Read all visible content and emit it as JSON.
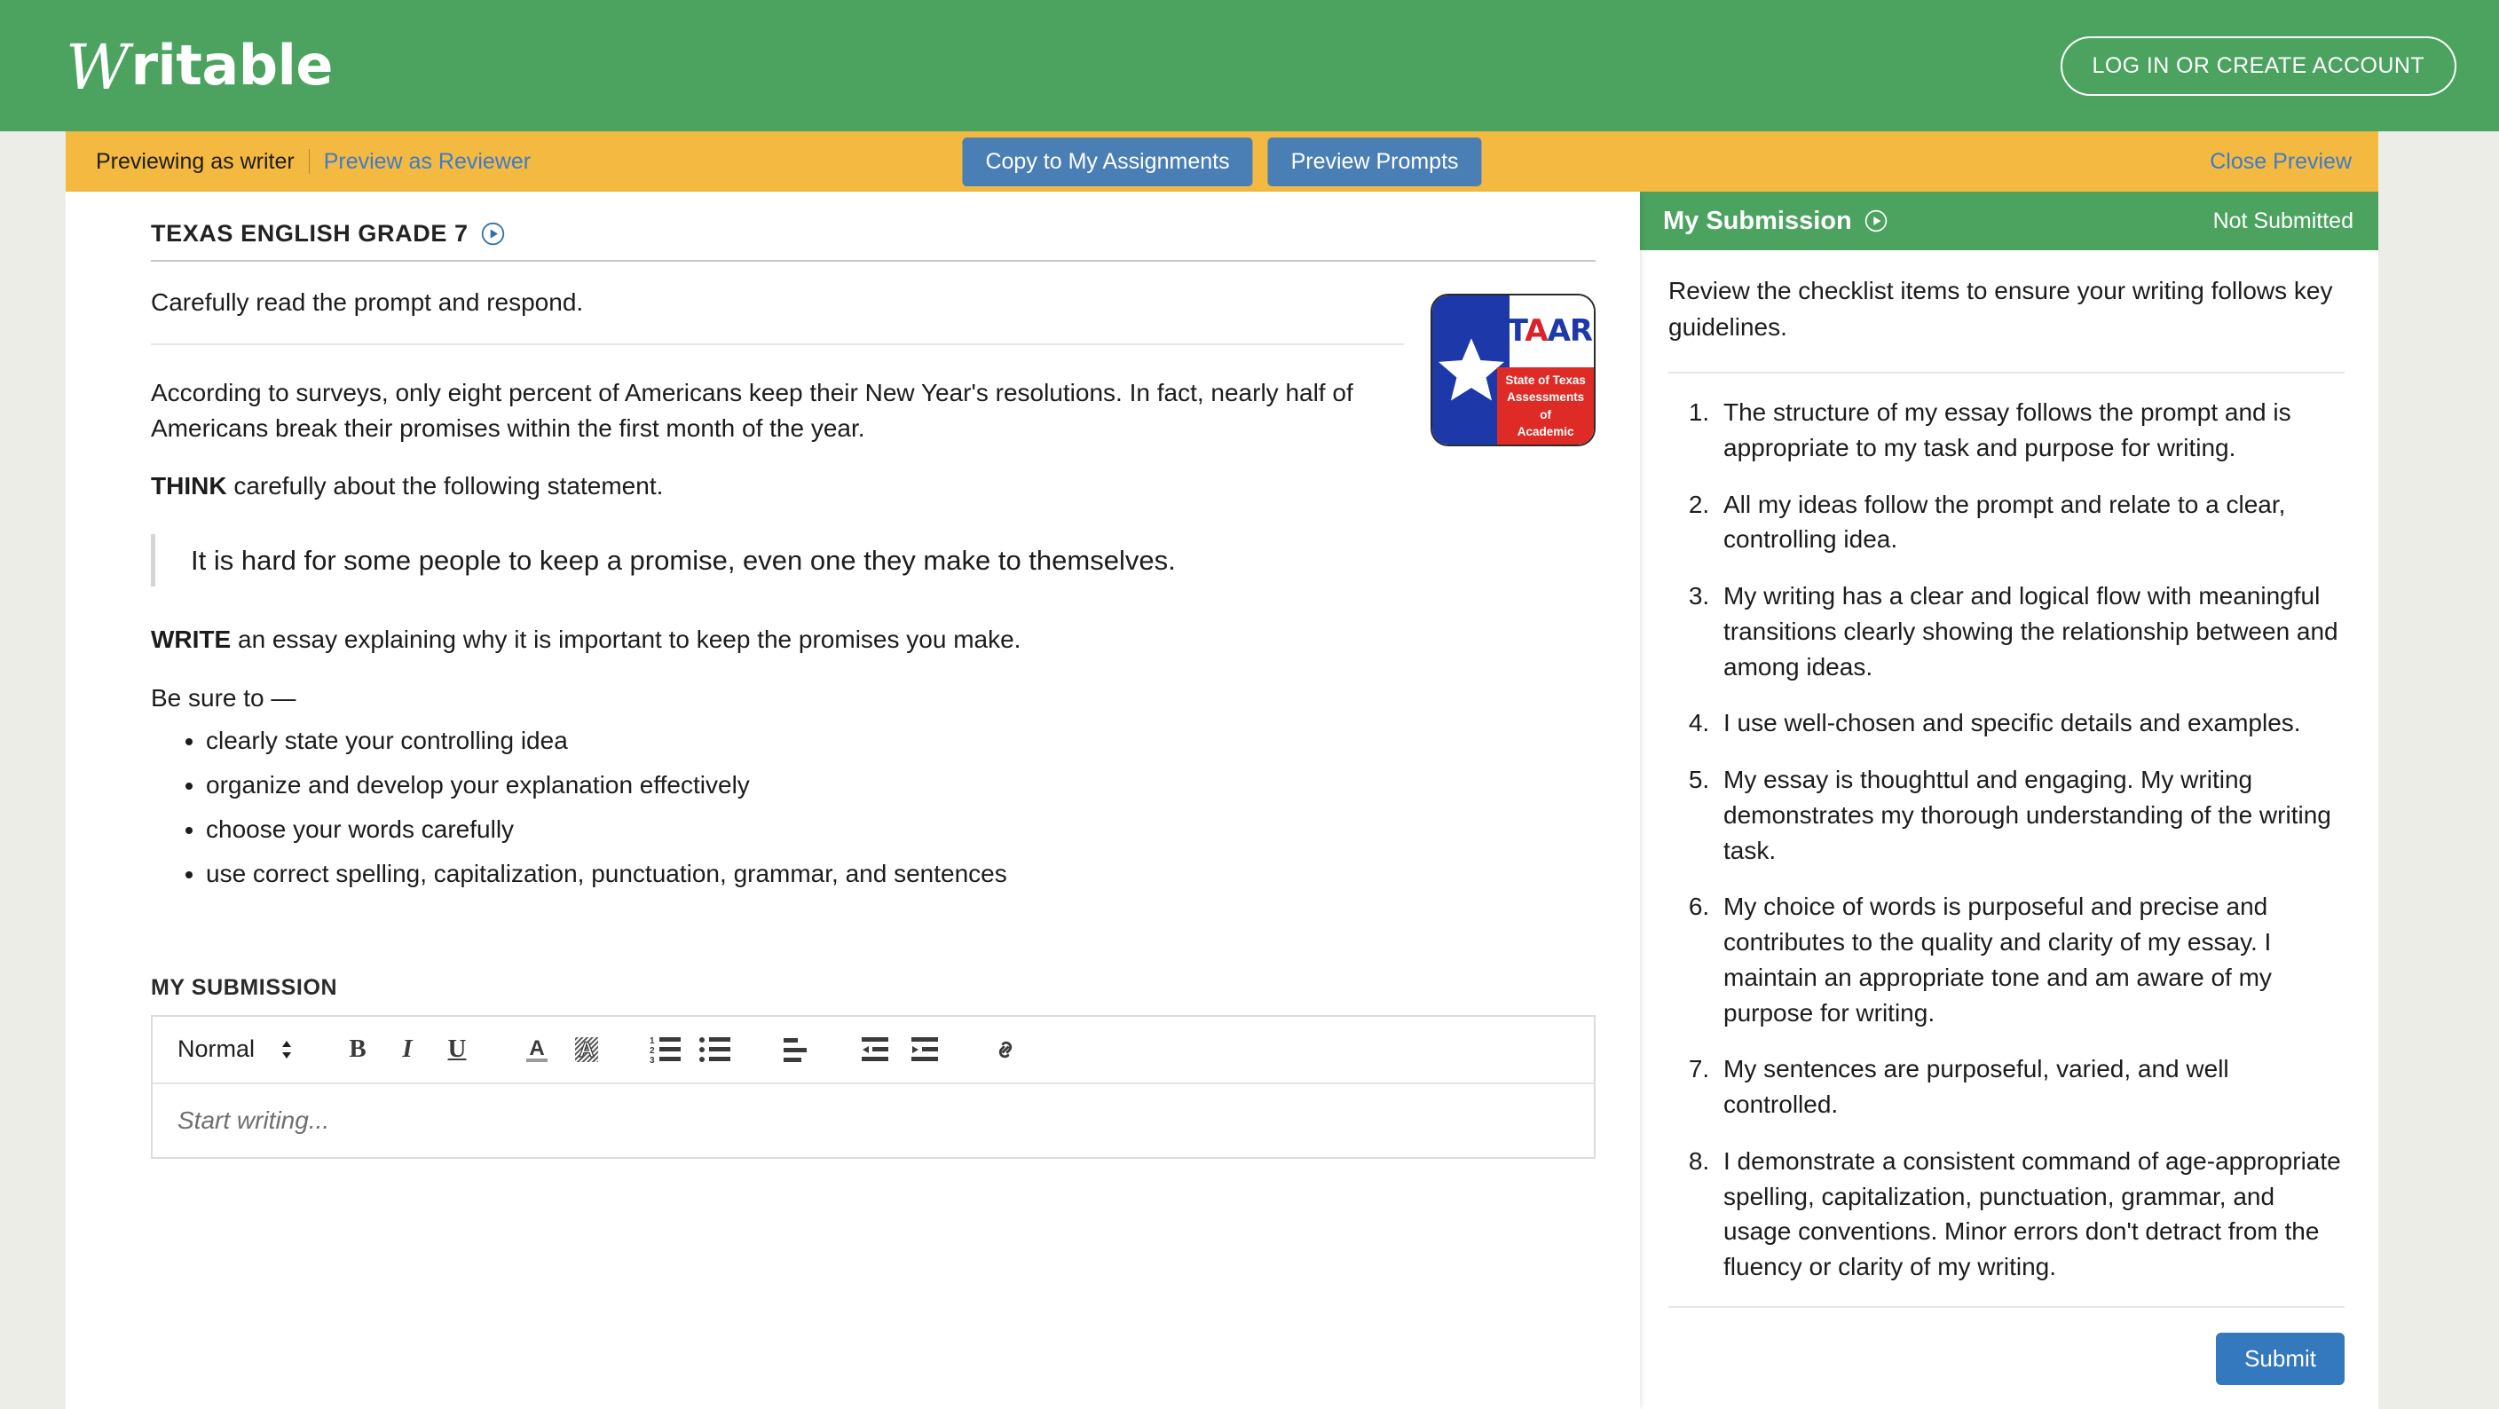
{
  "colors": {
    "brand_green": "#4ba35f",
    "preview_orange": "#f4b940",
    "link_blue": "#3d7cc9",
    "button_blue": "#4a7fb5",
    "submit_blue": "#3478bd",
    "page_background": "#ecede7"
  },
  "header": {
    "brand_w": "W",
    "brand_rest": "ritable",
    "login_label": "LOG IN OR CREATE ACCOUNT"
  },
  "preview_bar": {
    "status_text": "Previewing as writer",
    "reviewer_link": "Preview as Reviewer",
    "copy_button": "Copy to My Assignments",
    "prompts_button": "Preview Prompts",
    "close_link": "Close Preview"
  },
  "assignment": {
    "course_title": "TEXAS ENGLISH GRADE 7",
    "instruction": "Carefully read the prompt and respond.",
    "paragraph": "According to surveys, only eight percent of Americans keep their New Year's resolutions. In fact, nearly half of Americans break their promises within the first month of the year.",
    "think_bold": "THINK",
    "think_rest": " carefully about the following statement.",
    "statement": "It is hard for some people to keep a promise, even one they make to themselves.",
    "write_bold": "WRITE",
    "write_rest": " an essay explaining why it is important to keep the promises you make.",
    "be_sure_to": "Be sure to —",
    "bullets": [
      "clearly state your controlling idea",
      "organize and develop your explanation effectively",
      "choose your words carefully",
      "use correct spelling, capitalization, punctuation, grammar, and sentences"
    ]
  },
  "staar_logo": {
    "word_st": "ST",
    "word_a_red": "A",
    "word_ar": "AR",
    "line1": "State of Texas",
    "line2": "Assessments of",
    "line3": "Academic Readiness"
  },
  "submission": {
    "section_label": "MY SUBMISSION",
    "format_value": "Normal",
    "placeholder": "Start writing..."
  },
  "right_panel": {
    "title": "My Submission",
    "status": "Not Submitted",
    "intro": "Review the checklist items to ensure your writing follows key guidelines.",
    "checklist": [
      "The structure of my essay follows the prompt and is appropriate to my task and purpose for writing.",
      "All my ideas follow the prompt and relate to a clear, controlling idea.",
      "My writing has a clear and logical flow with meaningful transitions clearly showing the relationship between and among ideas.",
      "I use well-chosen and specific details and examples.",
      "My essay is thoughttul and engaging. My writing demonstrates my thorough understanding of the writing task.",
      "My choice of words is purposeful and precise and contributes to the quality and clarity of my essay. I maintain an appropriate tone and am aware of my purpose for writing.",
      "My sentences are purposeful, varied, and well controlled.",
      "I demonstrate a consistent command of age-appropriate spelling, capitalization, punctuation, grammar, and usage conventions. Minor errors don't detract from the fluency or clarity of my writing."
    ],
    "submit_label": "Submit"
  }
}
